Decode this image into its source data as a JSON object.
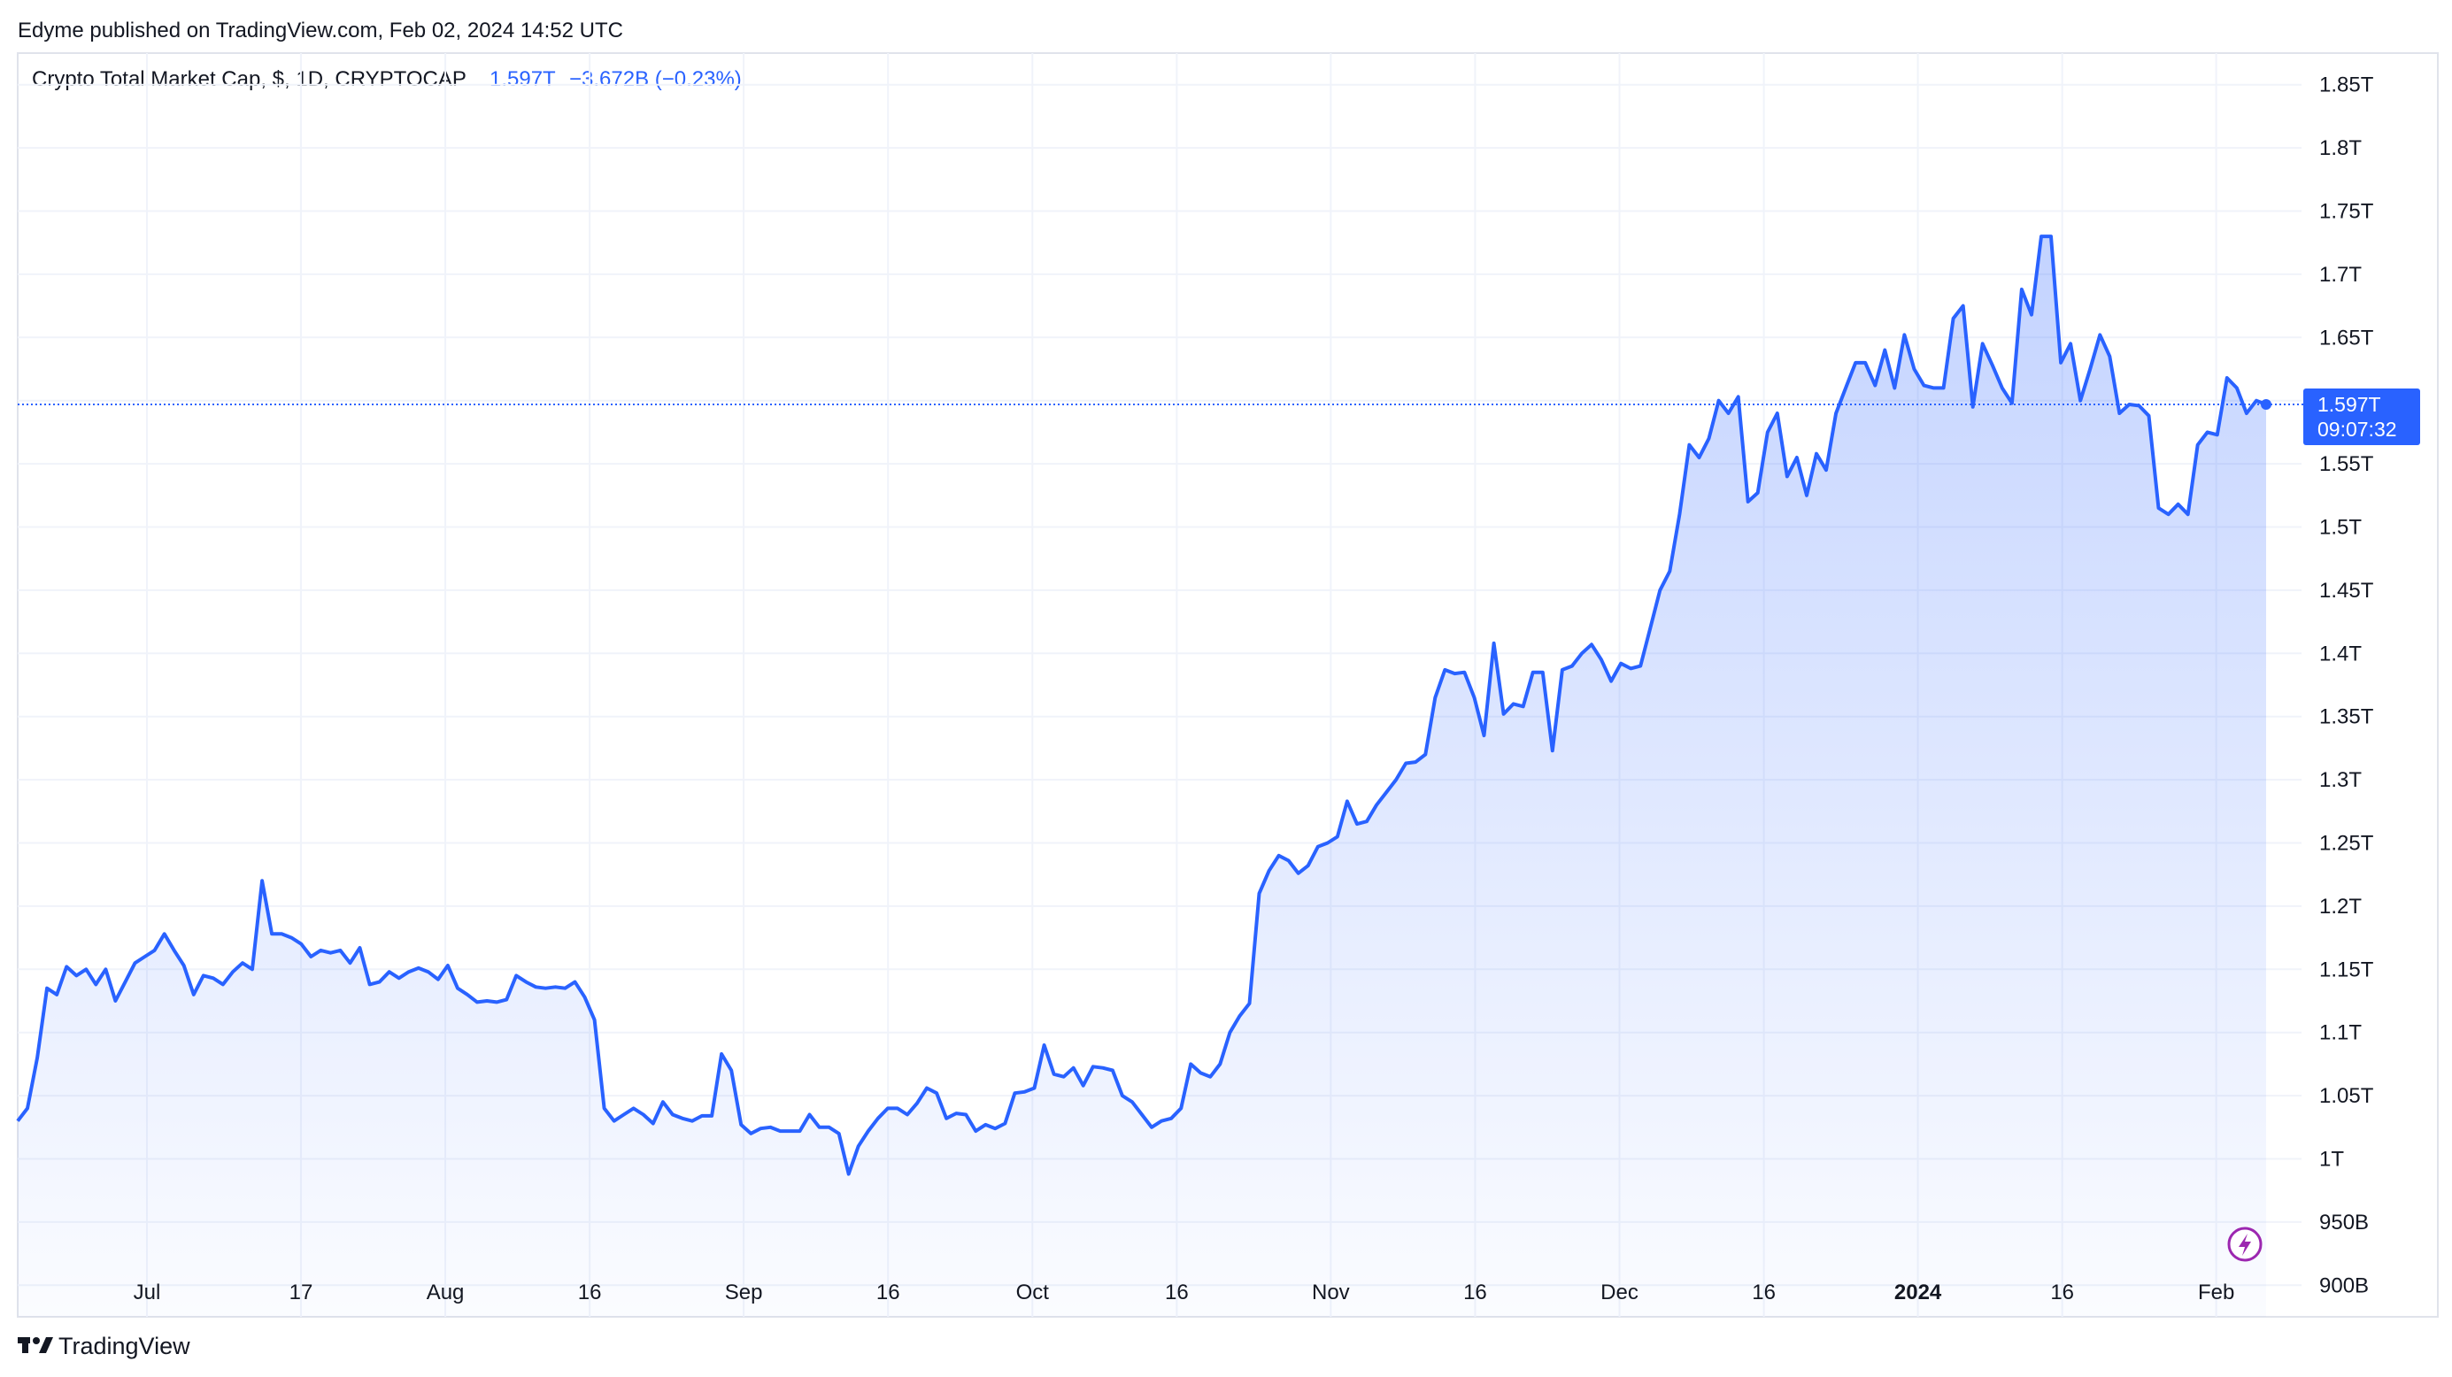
{
  "header": {
    "published": "Edyme published on TradingView.com, Feb 02, 2024 14:52 UTC",
    "symbol_title": "Crypto Total Market Cap, $, 1D, CRYPTOCAP",
    "last_value": "1.597T",
    "change": "−3.672B (−0.23%)"
  },
  "price_tag": {
    "value": "1.597T",
    "countdown": "09:07:32"
  },
  "footer": {
    "brand": "TradingView"
  },
  "colors": {
    "line": "#2962ff",
    "accent": "#2962ff",
    "grid": "#f0f3fa",
    "text": "#131722",
    "flash": "#9c27b0"
  },
  "icons": {
    "logo": "tradingview-logo-icon",
    "flash": "lightning-icon"
  },
  "chart_data": {
    "type": "area",
    "title": "Crypto Total Market Cap, $, 1D, CRYPTOCAP",
    "xlabel": "",
    "ylabel": "",
    "x_range": [
      "2023-06-23",
      "2024-02-02"
    ],
    "ylim": [
      0.875,
      1.875
    ],
    "y_unit": "T (trillion USD)",
    "y_ticks": [
      0.9,
      0.95,
      1.0,
      1.05,
      1.1,
      1.15,
      1.2,
      1.25,
      1.3,
      1.35,
      1.4,
      1.45,
      1.5,
      1.55,
      1.6,
      1.65,
      1.7,
      1.75,
      1.8,
      1.85
    ],
    "y_tick_labels": [
      "900B",
      "950B",
      "1T",
      "1.05T",
      "1.1T",
      "1.15T",
      "1.2T",
      "1.25T",
      "1.3T",
      "1.35T",
      "1.4T",
      "1.45T",
      "1.5T",
      "1.55T",
      "1.6T",
      "1.65T",
      "1.7T",
      "1.75T",
      "1.8T",
      "1.85T"
    ],
    "hidden_y_ticks": [
      "1.6T"
    ],
    "x_ticks": [
      {
        "date": "2023-07-01",
        "label": "Jul",
        "bold": false
      },
      {
        "date": "2023-07-17",
        "label": "17",
        "bold": false
      },
      {
        "date": "2023-08-01",
        "label": "Aug",
        "bold": false
      },
      {
        "date": "2023-08-16",
        "label": "16",
        "bold": false
      },
      {
        "date": "2023-09-01",
        "label": "Sep",
        "bold": false
      },
      {
        "date": "2023-09-16",
        "label": "16",
        "bold": false
      },
      {
        "date": "2023-10-01",
        "label": "Oct",
        "bold": false
      },
      {
        "date": "2023-10-16",
        "label": "16",
        "bold": false
      },
      {
        "date": "2023-11-01",
        "label": "Nov",
        "bold": false
      },
      {
        "date": "2023-11-16",
        "label": "16",
        "bold": false
      },
      {
        "date": "2023-12-01",
        "label": "Dec",
        "bold": false
      },
      {
        "date": "2023-12-16",
        "label": "16",
        "bold": false
      },
      {
        "date": "2024-01-01",
        "label": "2024",
        "bold": true
      },
      {
        "date": "2024-01-16",
        "label": "16",
        "bold": false
      },
      {
        "date": "2024-02-01",
        "label": "Feb",
        "bold": false
      }
    ],
    "last_value": 1.597,
    "series": [
      {
        "values": [
          [
            "2023-06-23",
            1.03
          ],
          [
            "2023-06-24",
            1.04
          ],
          [
            "2023-06-25",
            1.08
          ],
          [
            "2023-06-26",
            1.135
          ],
          [
            "2023-06-27",
            1.13
          ],
          [
            "2023-06-28",
            1.152
          ],
          [
            "2023-06-29",
            1.145
          ],
          [
            "2023-06-30",
            1.15
          ],
          [
            "2023-07-01",
            1.138
          ],
          [
            "2023-07-02",
            1.15
          ],
          [
            "2023-07-03",
            1.125
          ],
          [
            "2023-07-04",
            1.14
          ],
          [
            "2023-07-05",
            1.155
          ],
          [
            "2023-07-06",
            1.16
          ],
          [
            "2023-07-07",
            1.165
          ],
          [
            "2023-07-08",
            1.178
          ],
          [
            "2023-07-09",
            1.165
          ],
          [
            "2023-07-10",
            1.153
          ],
          [
            "2023-07-11",
            1.13
          ],
          [
            "2023-07-12",
            1.145
          ],
          [
            "2023-07-13",
            1.143
          ],
          [
            "2023-07-14",
            1.138
          ],
          [
            "2023-07-15",
            1.148
          ],
          [
            "2023-07-16",
            1.155
          ],
          [
            "2023-07-17",
            1.15
          ],
          [
            "2023-07-18",
            1.22
          ],
          [
            "2023-07-19",
            1.178
          ],
          [
            "2023-07-20",
            1.178
          ],
          [
            "2023-07-21",
            1.175
          ],
          [
            "2023-07-22",
            1.17
          ],
          [
            "2023-07-23",
            1.16
          ],
          [
            "2023-07-24",
            1.165
          ],
          [
            "2023-07-25",
            1.163
          ],
          [
            "2023-07-26",
            1.165
          ],
          [
            "2023-07-27",
            1.155
          ],
          [
            "2023-07-28",
            1.167
          ],
          [
            "2023-07-29",
            1.138
          ],
          [
            "2023-07-30",
            1.14
          ],
          [
            "2023-07-31",
            1.148
          ],
          [
            "2023-08-01",
            1.143
          ],
          [
            "2023-08-02",
            1.148
          ],
          [
            "2023-08-03",
            1.151
          ],
          [
            "2023-08-04",
            1.148
          ],
          [
            "2023-08-05",
            1.142
          ],
          [
            "2023-08-06",
            1.153
          ],
          [
            "2023-08-07",
            1.135
          ],
          [
            "2023-08-08",
            1.13
          ],
          [
            "2023-08-09",
            1.124
          ],
          [
            "2023-08-10",
            1.125
          ],
          [
            "2023-08-11",
            1.124
          ],
          [
            "2023-08-12",
            1.126
          ],
          [
            "2023-08-13",
            1.145
          ],
          [
            "2023-08-14",
            1.14
          ],
          [
            "2023-08-15",
            1.136
          ],
          [
            "2023-08-16",
            1.135
          ],
          [
            "2023-08-17",
            1.136
          ],
          [
            "2023-08-18",
            1.135
          ],
          [
            "2023-08-19",
            1.14
          ],
          [
            "2023-08-20",
            1.128
          ],
          [
            "2023-08-21",
            1.11
          ],
          [
            "2023-08-22",
            1.04
          ],
          [
            "2023-08-23",
            1.03
          ],
          [
            "2023-08-24",
            1.035
          ],
          [
            "2023-08-25",
            1.04
          ],
          [
            "2023-08-26",
            1.035
          ],
          [
            "2023-08-27",
            1.028
          ],
          [
            "2023-08-28",
            1.045
          ],
          [
            "2023-08-29",
            1.035
          ],
          [
            "2023-08-30",
            1.032
          ],
          [
            "2023-08-31",
            1.03
          ],
          [
            "2023-09-01",
            1.034
          ],
          [
            "2023-09-02",
            1.034
          ],
          [
            "2023-09-03",
            1.083
          ],
          [
            "2023-09-04",
            1.07
          ],
          [
            "2023-09-05",
            1.027
          ],
          [
            "2023-09-06",
            1.02
          ],
          [
            "2023-09-07",
            1.024
          ],
          [
            "2023-09-08",
            1.025
          ],
          [
            "2023-09-09",
            1.022
          ],
          [
            "2023-09-10",
            1.022
          ],
          [
            "2023-09-11",
            1.022
          ],
          [
            "2023-09-12",
            1.035
          ],
          [
            "2023-09-13",
            1.025
          ],
          [
            "2023-09-14",
            1.025
          ],
          [
            "2023-09-15",
            1.02
          ],
          [
            "2023-09-16",
            0.988
          ],
          [
            "2023-09-17",
            1.01
          ],
          [
            "2023-09-18",
            1.022
          ],
          [
            "2023-09-19",
            1.032
          ],
          [
            "2023-09-20",
            1.04
          ],
          [
            "2023-09-21",
            1.04
          ],
          [
            "2023-09-22",
            1.035
          ],
          [
            "2023-09-23",
            1.044
          ],
          [
            "2023-09-24",
            1.056
          ],
          [
            "2023-09-25",
            1.052
          ],
          [
            "2023-09-26",
            1.032
          ],
          [
            "2023-09-27",
            1.036
          ],
          [
            "2023-09-28",
            1.035
          ],
          [
            "2023-09-29",
            1.022
          ],
          [
            "2023-09-30",
            1.027
          ],
          [
            "2023-10-01",
            1.024
          ],
          [
            "2023-10-02",
            1.028
          ],
          [
            "2023-10-03",
            1.052
          ],
          [
            "2023-10-04",
            1.053
          ],
          [
            "2023-10-05",
            1.056
          ],
          [
            "2023-10-06",
            1.09
          ],
          [
            "2023-10-07",
            1.067
          ],
          [
            "2023-10-08",
            1.065
          ],
          [
            "2023-10-09",
            1.072
          ],
          [
            "2023-10-10",
            1.058
          ],
          [
            "2023-10-11",
            1.073
          ],
          [
            "2023-10-12",
            1.072
          ],
          [
            "2023-10-13",
            1.07
          ],
          [
            "2023-10-14",
            1.05
          ],
          [
            "2023-10-15",
            1.045
          ],
          [
            "2023-10-16",
            1.035
          ],
          [
            "2023-10-17",
            1.025
          ],
          [
            "2023-10-18",
            1.03
          ],
          [
            "2023-10-19",
            1.032
          ],
          [
            "2023-10-20",
            1.04
          ],
          [
            "2023-10-21",
            1.075
          ],
          [
            "2023-10-22",
            1.068
          ],
          [
            "2023-10-23",
            1.065
          ],
          [
            "2023-10-24",
            1.075
          ],
          [
            "2023-10-25",
            1.1
          ],
          [
            "2023-10-26",
            1.113
          ],
          [
            "2023-10-27",
            1.123
          ],
          [
            "2023-10-28",
            1.21
          ],
          [
            "2023-10-29",
            1.228
          ],
          [
            "2023-10-30",
            1.24
          ],
          [
            "2023-10-31",
            1.236
          ],
          [
            "2023-11-01",
            1.226
          ],
          [
            "2023-11-02",
            1.232
          ],
          [
            "2023-11-03",
            1.247
          ],
          [
            "2023-11-04",
            1.25
          ],
          [
            "2023-11-05",
            1.255
          ],
          [
            "2023-11-06",
            1.283
          ],
          [
            "2023-11-07",
            1.265
          ],
          [
            "2023-11-08",
            1.267
          ],
          [
            "2023-11-09",
            1.28
          ],
          [
            "2023-11-10",
            1.29
          ],
          [
            "2023-11-11",
            1.3
          ],
          [
            "2023-11-12",
            1.313
          ],
          [
            "2023-11-13",
            1.314
          ],
          [
            "2023-11-14",
            1.32
          ],
          [
            "2023-11-15",
            1.365
          ],
          [
            "2023-11-16",
            1.387
          ],
          [
            "2023-11-17",
            1.384
          ],
          [
            "2023-11-18",
            1.385
          ],
          [
            "2023-11-19",
            1.365
          ],
          [
            "2023-11-20",
            1.335
          ],
          [
            "2023-11-21",
            1.408
          ],
          [
            "2023-11-22",
            1.352
          ],
          [
            "2023-11-23",
            1.36
          ],
          [
            "2023-11-24",
            1.358
          ],
          [
            "2023-11-25",
            1.385
          ],
          [
            "2023-11-26",
            1.385
          ],
          [
            "2023-11-27",
            1.323
          ],
          [
            "2023-11-28",
            1.387
          ],
          [
            "2023-11-29",
            1.39
          ],
          [
            "2023-11-30",
            1.4
          ],
          [
            "2023-12-01",
            1.407
          ],
          [
            "2023-12-02",
            1.395
          ],
          [
            "2023-12-03",
            1.378
          ],
          [
            "2023-12-04",
            1.392
          ],
          [
            "2023-12-05",
            1.388
          ],
          [
            "2023-12-06",
            1.39
          ],
          [
            "2023-12-07",
            1.42
          ],
          [
            "2023-12-08",
            1.45
          ],
          [
            "2023-12-09",
            1.465
          ],
          [
            "2023-12-10",
            1.51
          ],
          [
            "2023-12-11",
            1.565
          ],
          [
            "2023-12-12",
            1.555
          ],
          [
            "2023-12-13",
            1.57
          ],
          [
            "2023-12-14",
            1.6
          ],
          [
            "2023-12-15",
            1.59
          ],
          [
            "2023-12-16",
            1.603
          ],
          [
            "2023-12-17",
            1.52
          ],
          [
            "2023-12-18",
            1.527
          ],
          [
            "2023-12-19",
            1.575
          ],
          [
            "2023-12-20",
            1.59
          ],
          [
            "2023-12-21",
            1.54
          ],
          [
            "2023-12-22",
            1.555
          ],
          [
            "2023-12-23",
            1.525
          ],
          [
            "2023-12-24",
            1.558
          ],
          [
            "2023-12-25",
            1.545
          ],
          [
            "2023-12-26",
            1.59
          ],
          [
            "2023-12-27",
            1.61
          ],
          [
            "2023-12-28",
            1.63
          ],
          [
            "2023-12-29",
            1.63
          ],
          [
            "2023-12-30",
            1.612
          ],
          [
            "2023-12-31",
            1.64
          ],
          [
            "2024-01-01",
            1.61
          ],
          [
            "2024-01-02",
            1.652
          ],
          [
            "2024-01-03",
            1.625
          ],
          [
            "2024-01-04",
            1.612
          ],
          [
            "2024-01-05",
            1.61
          ],
          [
            "2024-01-06",
            1.61
          ],
          [
            "2024-01-07",
            1.665
          ],
          [
            "2024-01-08",
            1.675
          ],
          [
            "2024-01-09",
            1.595
          ],
          [
            "2024-01-10",
            1.645
          ],
          [
            "2024-01-11",
            1.628
          ],
          [
            "2024-01-12",
            1.61
          ],
          [
            "2024-01-13",
            1.598
          ],
          [
            "2024-01-14",
            1.688
          ],
          [
            "2024-01-15",
            1.668
          ],
          [
            "2024-01-16",
            1.73
          ],
          [
            "2024-01-17",
            1.73
          ],
          [
            "2024-01-18",
            1.63
          ],
          [
            "2024-01-19",
            1.645
          ],
          [
            "2024-01-20",
            1.6
          ],
          [
            "2024-01-21",
            1.625
          ],
          [
            "2024-01-22",
            1.652
          ],
          [
            "2024-01-23",
            1.635
          ],
          [
            "2024-01-24",
            1.59
          ],
          [
            "2024-01-25",
            1.597
          ],
          [
            "2024-01-26",
            1.596
          ],
          [
            "2024-01-27",
            1.588
          ],
          [
            "2024-01-28",
            1.515
          ],
          [
            "2024-01-29",
            1.51
          ],
          [
            "2024-01-30",
            1.518
          ],
          [
            "2024-01-31",
            1.51
          ],
          [
            "2024-02-01",
            1.565
          ],
          [
            "2024-02-02",
            1.575
          ],
          [
            "2024-02-03",
            1.573
          ],
          [
            "2024-02-04",
            1.618
          ],
          [
            "2024-02-05",
            1.61
          ],
          [
            "2024-02-06",
            1.59
          ],
          [
            "2024-02-07",
            1.6
          ],
          [
            "2024-02-08",
            1.597
          ]
        ]
      }
    ]
  }
}
